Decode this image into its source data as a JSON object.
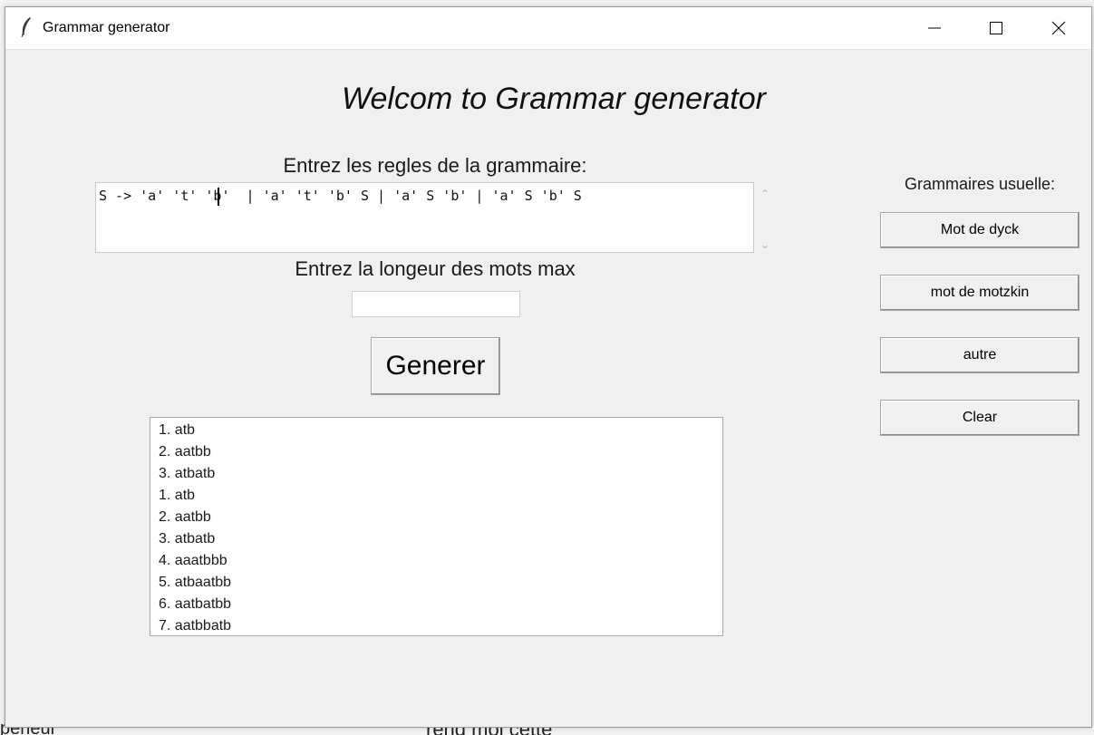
{
  "window": {
    "title": "Grammar generator",
    "controls": {
      "minimize_icon": "minimize-icon",
      "maximize_icon": "maximize-icon",
      "close_icon": "close-icon"
    }
  },
  "main": {
    "heading": "Welcom to Grammar generator",
    "rules_label": "Entrez les regles de la grammaire:",
    "rules_value": "S -> 'a' 't' 'b'  | 'a' 't' 'b' S | 'a' S 'b' | 'a' S 'b' S",
    "length_label": "Entrez la longeur des mots max",
    "length_value": "",
    "generate_label": "Generer",
    "results": [
      "1. atb",
      "2. aatbb",
      "3. atbatb",
      "1. atb",
      "2. aatbb",
      "3. atbatb",
      "4. aaatbbb",
      "5. atbaatbb",
      "6. aatbatbb",
      "7. aatbbatb"
    ]
  },
  "sidebar": {
    "label": "Grammaires usuelle:",
    "buttons": [
      "Mot de dyck",
      "mot de motzkin",
      "autre",
      "Clear"
    ]
  },
  "background": {
    "fragments": [
      "perieur",
      "rend moi cette"
    ]
  }
}
